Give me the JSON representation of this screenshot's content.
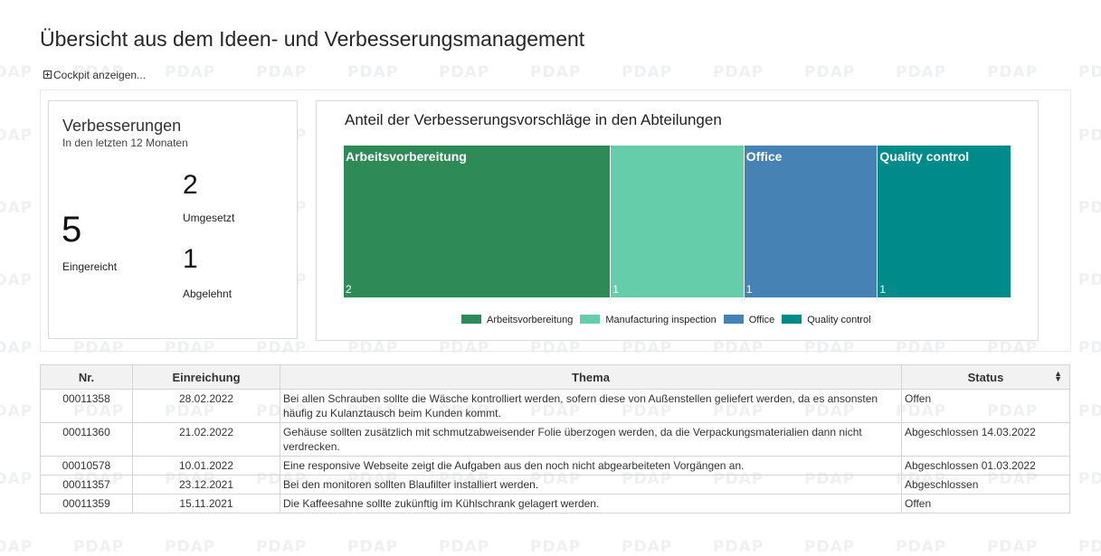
{
  "watermark": {
    "text": "PDAP"
  },
  "page": {
    "title": "Übersicht aus dem Ideen- und Verbesserungsmanagement"
  },
  "cockpit": {
    "label": "Cockpit anzeigen..."
  },
  "kpi": {
    "title": "Verbesserungen",
    "subtitle": "In den letzten 12 Monaten",
    "submitted_value": "5",
    "submitted_label": "Eingereicht",
    "implemented_value": "2",
    "implemented_label": "Umgesetzt",
    "rejected_value": "1",
    "rejected_label": "Abgelehnt"
  },
  "chart": {
    "title": "Anteil der Verbesserungsvorschläge in den Abteilungen",
    "tiles": [
      {
        "label": "Arbeitsvorbereitung",
        "value": "2"
      },
      {
        "label": "",
        "value": "1"
      },
      {
        "label": "Office",
        "value": "1"
      },
      {
        "label": "Quality control",
        "value": "1"
      }
    ],
    "legend": [
      "Arbeitsvorbereitung",
      "Manufacturing inspection",
      "Office",
      "Quality control"
    ]
  },
  "chart_data": {
    "type": "treemap",
    "title": "Anteil der Verbesserungsvorschläge in den Abteilungen",
    "categories": [
      "Arbeitsvorbereitung",
      "Manufacturing inspection",
      "Office",
      "Quality control"
    ],
    "values": [
      2,
      1,
      1,
      1
    ],
    "colors": [
      "#2e8b57",
      "#66cdaa",
      "#4682b4",
      "#008b8b"
    ],
    "legend_position": "bottom"
  },
  "table": {
    "headers": {
      "nr": "Nr.",
      "date": "Einreichung",
      "topic": "Thema",
      "status": "Status"
    },
    "sort_icon": "sort-icon",
    "rows": [
      {
        "nr": "00011358",
        "date": "28.02.2022",
        "topic": "Bei allen Schrauben sollte die Wäsche kontrolliert werden, sofern diese von Außenstellen geliefert werden, da es ansonsten häufig zu Kulanztausch beim Kunden kommt.",
        "status": "Offen"
      },
      {
        "nr": "00011360",
        "date": "21.02.2022",
        "topic": "Gehäuse sollten zusätzlich mit schmutzabweisender Folie überzogen werden, da die Verpackungsmaterialien dann nicht verdrecken.",
        "status": "Abgeschlossen 14.03.2022"
      },
      {
        "nr": "00010578",
        "date": "10.01.2022",
        "topic": "Eine responsive Webseite zeigt die Aufgaben aus den noch nicht abgearbeiteten Vorgängen an.",
        "status": "Abgeschlossen 01.03.2022"
      },
      {
        "nr": "00011357",
        "date": "23.12.2021",
        "topic": "Bei den monitoren sollten Blaufilter installiert werden.",
        "status": "Abgeschlossen"
      },
      {
        "nr": "00011359",
        "date": "15.11.2021",
        "topic": "Die Kaffeesahne sollte zukünftig im Kühlschrank gelagert werden.",
        "status": "Offen"
      }
    ]
  }
}
